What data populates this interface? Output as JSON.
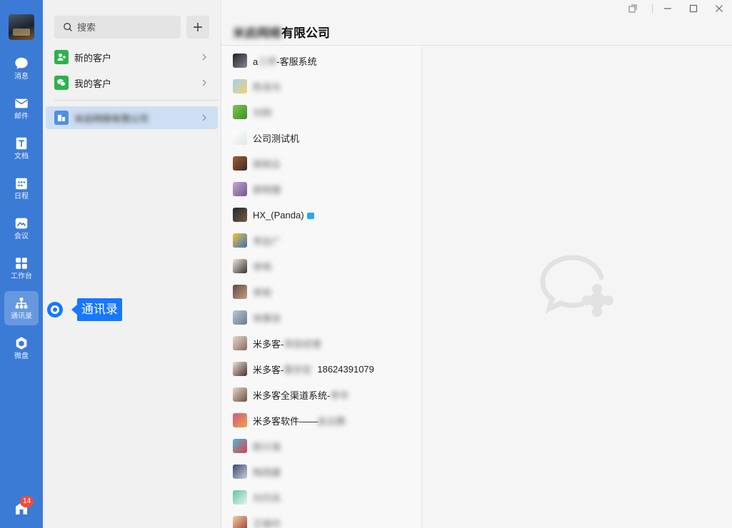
{
  "rail": {
    "items": [
      {
        "label": "消息",
        "icon": "chat-bubble-icon"
      },
      {
        "label": "邮件",
        "icon": "mail-icon"
      },
      {
        "label": "文档",
        "icon": "document-icon"
      },
      {
        "label": "日程",
        "icon": "calendar-icon"
      },
      {
        "label": "会议",
        "icon": "meeting-icon"
      },
      {
        "label": "工作台",
        "icon": "workbench-icon"
      },
      {
        "label": "通讯录",
        "icon": "org-chart-icon"
      },
      {
        "label": "微盘",
        "icon": "drive-icon"
      }
    ],
    "badge": "14"
  },
  "sidebar": {
    "search_placeholder": "搜索",
    "add_label": "+",
    "menu": [
      {
        "label": "新的客户"
      },
      {
        "label": "我的客户"
      },
      {
        "label": "米启网络有限公司"
      }
    ]
  },
  "header": {
    "company_blurred": "米启网络",
    "company_visible": "有限公司"
  },
  "contacts": [
    {
      "name_prefix": "a",
      "name_blur": "三师",
      "name_suffix": "-客服系统",
      "phone": ""
    },
    {
      "name_prefix": "",
      "name_blur": "陈佳均",
      "name_suffix": "",
      "phone": ""
    },
    {
      "name_prefix": "",
      "name_blur": "刘明",
      "name_suffix": "",
      "phone": ""
    },
    {
      "name_prefix": "公司测试机",
      "name_blur": "",
      "name_suffix": "",
      "phone": ""
    },
    {
      "name_prefix": "",
      "name_blur": "郭刚云",
      "name_suffix": "",
      "phone": ""
    },
    {
      "name_prefix": "",
      "name_blur": "郭明珊",
      "name_suffix": "",
      "phone": ""
    },
    {
      "name_prefix": "HX_(Panda)",
      "name_blur": "",
      "name_suffix": "",
      "phone": "",
      "chat_flag": true
    },
    {
      "name_prefix": "",
      "name_blur": "李启广",
      "name_suffix": "",
      "phone": ""
    },
    {
      "name_prefix": "",
      "name_blur": "李明",
      "name_suffix": "",
      "phone": ""
    },
    {
      "name_prefix": "",
      "name_blur": "李刚",
      "name_suffix": "",
      "phone": ""
    },
    {
      "name_prefix": "",
      "name_blur": "林惠琼",
      "name_suffix": "",
      "phone": ""
    },
    {
      "name_prefix": "米多客-",
      "name_blur": "项目经理",
      "name_suffix": "",
      "phone": ""
    },
    {
      "name_prefix": "米多客-",
      "name_blur": "黎亦宏",
      "name_suffix": "",
      "phone": "18624391079"
    },
    {
      "name_prefix": "米多客全渠道系统-",
      "name_blur": "李华",
      "name_suffix": "",
      "phone": ""
    },
    {
      "name_prefix": "米多客软件——",
      "name_blur": "赵云鹏",
      "name_suffix": "",
      "phone": ""
    },
    {
      "name_prefix": "",
      "name_blur": "欧兴海",
      "name_suffix": "",
      "phone": ""
    },
    {
      "name_prefix": "",
      "name_blur": "陶雨婕",
      "name_suffix": "",
      "phone": ""
    },
    {
      "name_prefix": "",
      "name_blur": "刘丹凤",
      "name_suffix": "",
      "phone": ""
    },
    {
      "name_prefix": "",
      "name_blur": "王晓玲",
      "name_suffix": "",
      "phone": ""
    }
  ],
  "annotation": {
    "label": "通讯录"
  },
  "colors": {
    "rail": "#3b7bd6",
    "accent": "#1677ff",
    "selected_row": "#cfdff3",
    "badge": "#f04a3e"
  }
}
